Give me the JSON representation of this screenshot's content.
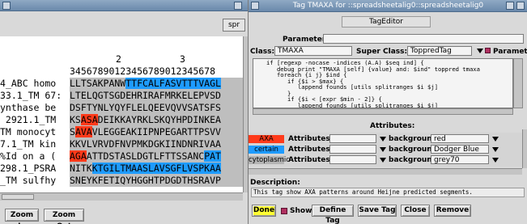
{
  "left_window": {
    "topbar_button": "spr",
    "ruler": {
      "major_2": "2",
      "major_3": "3",
      "digits": "34567890123456789012345678"
    },
    "rows": [
      {
        "name": "4_ABC homo",
        "segments": [
          {
            "t": "LLTSAKPANW",
            "c": ""
          },
          {
            "t": "TTFCALFASVTTTVAGL",
            "c": "blue"
          }
        ]
      },
      {
        "name": "33.1_TM 67:",
        "segments": [
          {
            "t": "LTELQGTSGDEHRIRAFMRKELEPVSD",
            "c": ""
          }
        ]
      },
      {
        "name": "ynthase be",
        "segments": [
          {
            "t": "DSFTYNLYQYFLELQEEVQVVSATSFS",
            "c": ""
          }
        ]
      },
      {
        "name": " 2921.1_TM",
        "segments": [
          {
            "t": "KS",
            "c": ""
          },
          {
            "t": "ASA",
            "c": "red"
          },
          {
            "t": "DEIKKAYRKLSKQYHPDINKEA",
            "c": ""
          }
        ]
      },
      {
        "name": "TM monocyt",
        "segments": [
          {
            "t": "S",
            "c": ""
          },
          {
            "t": "AVA",
            "c": "red"
          },
          {
            "t": "VLEGGEAKIIPNPEGARTTPSVV",
            "c": ""
          }
        ]
      },
      {
        "name": "7.1_TM kin",
        "segments": [
          {
            "t": "KKVLVRVDFNVPMKDGKIINDNRIVAA",
            "c": ""
          }
        ]
      },
      {
        "name": "%Id on a (",
        "segments": [
          {
            "t": "AGA",
            "c": "red"
          },
          {
            "t": "ATTDSTASLDGTLFTTSSANC",
            "c": ""
          },
          {
            "t": "PAT",
            "c": "blue"
          }
        ]
      },
      {
        "name": "298.1_PSRA",
        "segments": [
          {
            "t": "NITK",
            "c": ""
          },
          {
            "t": "KTGILTMAASLAVSGFLVSPKAA",
            "c": "blue"
          }
        ]
      },
      {
        "name": "_TM sulfhy",
        "segments": [
          {
            "t": "SNEYKFETIQYHGGHTPDGDTHSRAVP",
            "c": ""
          }
        ]
      }
    ],
    "zoom_in": "Zoom In",
    "zoom_out": "Zoom Out"
  },
  "right_window": {
    "title": "Tag TMAXA for ::spreadsheetalig0::spreadsheetalig0",
    "tab": "TagEditor",
    "parameter_label": "Parameter:",
    "parameter_value": "",
    "class_label": "Class:",
    "class_value": "TMAXA",
    "superclass_label": "Super Class:",
    "superclass_value": "ToppredTag",
    "parameter_check_label": "Paramete",
    "code_lines": [
      "   if [regexp -nocase -indices (A.A) $seq ind] {",
      "      debug print \"TMAXA [self] {value} and: $ind\" toppred tmaxa",
      "      foreach {i j} $ind {",
      "         if {$i > $max} {",
      "            lappend founds [utils splitranges $i $j]",
      "         }",
      "         if {$i < [expr $min - 2]} {",
      "            lappend founds [utils splitranges $i $j]",
      "         }"
    ],
    "attributes_header": "Attributes:",
    "attr_rows": [
      {
        "tag": "AXA",
        "tag_color": "#ff3a1a",
        "attr_label": "Attributes:",
        "attr_value": "",
        "bg_label": "background:",
        "bg_value": "red"
      },
      {
        "tag": "certain",
        "tag_color": "#1e9bff",
        "attr_label": "Attributes:",
        "attr_value": "",
        "bg_label": "background:",
        "bg_value": "Dodger Blue"
      },
      {
        "tag": "cytoplasmic",
        "tag_color": "#b3b3b3",
        "attr_label": "Attributes:",
        "attr_value": "",
        "bg_label": "background:",
        "bg_value": "grey70"
      }
    ],
    "description_label": "Description:",
    "description_text": "This tag show AXA patterns around Heijne predicted segments.",
    "buttons": {
      "done": "Done",
      "show": "Show",
      "define_tag": "Define Tag",
      "save_tag": "Save Tag",
      "close": "Close",
      "remove": "Remove"
    },
    "colors": {
      "done_button": "#ffff33",
      "show_check": "#b03060"
    }
  }
}
